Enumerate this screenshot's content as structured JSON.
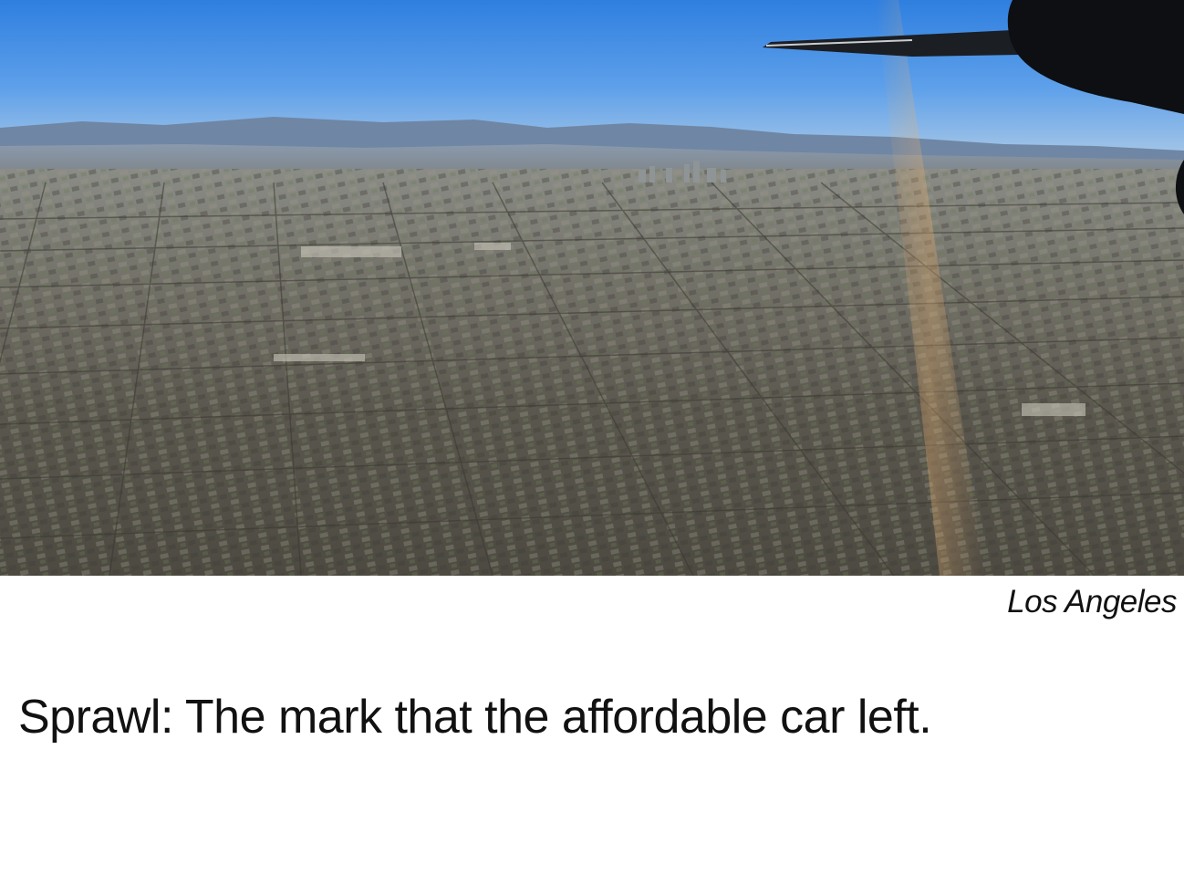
{
  "slide": {
    "photo_caption": "Los Angeles",
    "headline": "Sprawl: The mark that the affordable car left."
  },
  "photo": {
    "subject": "aerial-view-of-city-grid",
    "colors": {
      "sky_top": "#2f7fe0",
      "sky_horizon": "#a9c8e6",
      "mountains": "#6f86a4",
      "city_far": "#8a8c86",
      "city_near": "#4d4a42",
      "wing": "#0d0f12"
    }
  }
}
